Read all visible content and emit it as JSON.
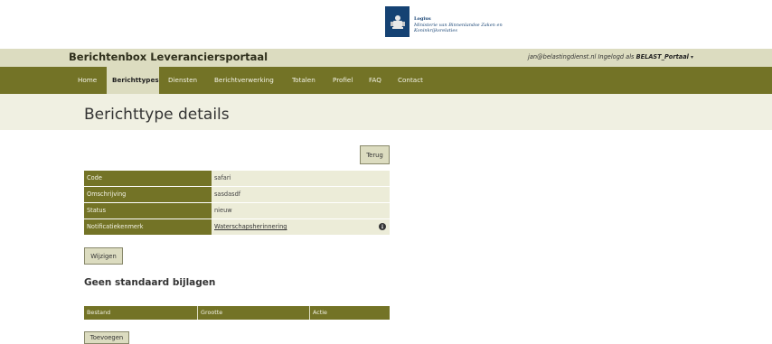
{
  "logo": {
    "line1": "Logius",
    "line2": "Ministerie van Binnenlandse Zaken en",
    "line3": "Koninkrijksrelaties"
  },
  "header": {
    "site_title": "Berichtenbox Leveranciersportaal",
    "user_email": "jan@belastingdienst.nl",
    "logged_in_text": "Ingelogd als",
    "account": "BELAST_Portaal",
    "caret": "▾"
  },
  "nav": {
    "items": [
      {
        "label": "Home"
      },
      {
        "label": "Berichttypes"
      },
      {
        "label": "Diensten"
      },
      {
        "label": "Berichtverwerking"
      },
      {
        "label": "Totalen"
      },
      {
        "label": "Profiel"
      },
      {
        "label": "FAQ"
      },
      {
        "label": "Contact"
      }
    ],
    "active": "Berichttypes"
  },
  "page": {
    "title": "Berichttype details",
    "back_button": "Terug",
    "edit_button": "Wijzigen",
    "attachments_heading": "Geen standaard bijlagen",
    "add_button": "Toevoegen"
  },
  "details": {
    "rows": [
      {
        "label": "Code",
        "value": "safari"
      },
      {
        "label": "Omschrijving",
        "value": "sasdasdf"
      },
      {
        "label": "Status",
        "value": "nieuw"
      },
      {
        "label": "Notificatiekenmerk",
        "value": "Waterschapsherinnering"
      }
    ]
  },
  "attachments": {
    "columns": [
      "Bestand",
      "Grootte",
      "Actie"
    ]
  },
  "colors": {
    "nav_bg": "#737326",
    "header_bg": "#dcdcc0",
    "band_bg": "#f0f0e2",
    "logo_blue": "#154273"
  }
}
